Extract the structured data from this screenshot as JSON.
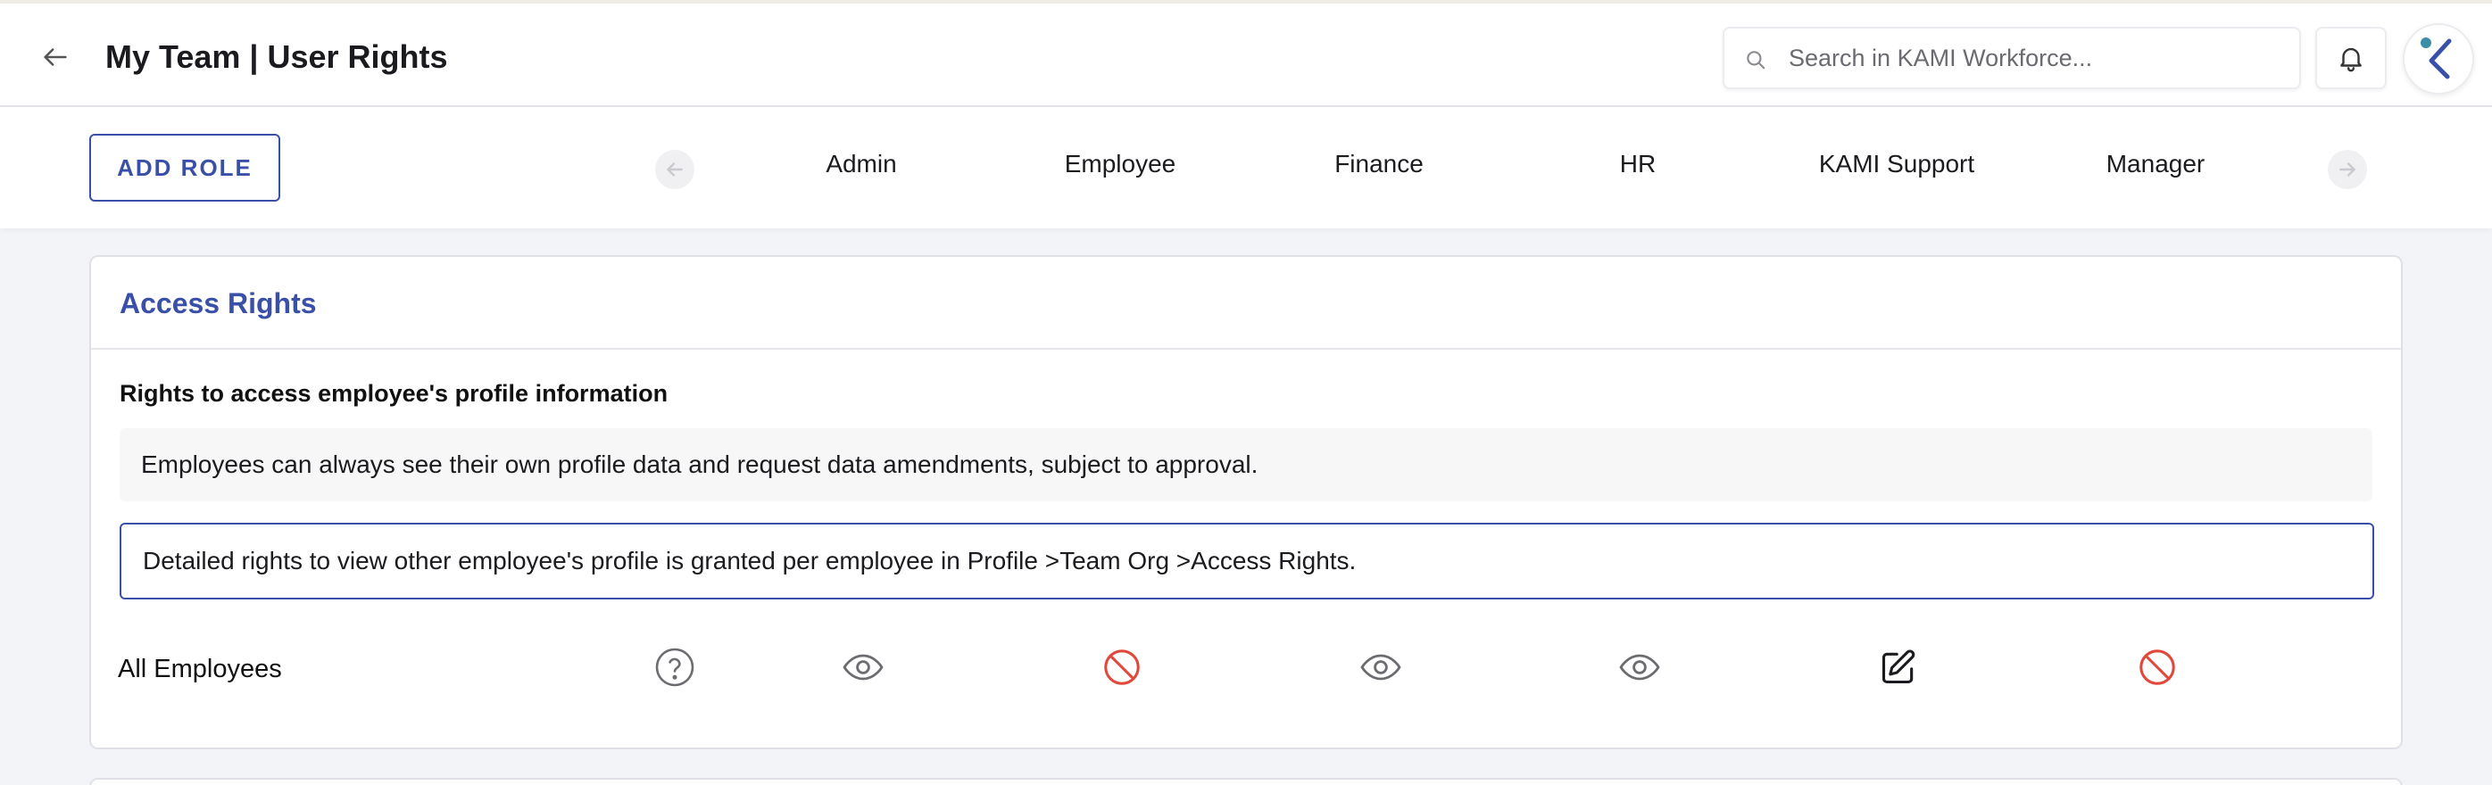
{
  "header": {
    "title": "My Team | User Rights",
    "back_icon": "arrow-left-icon",
    "search": {
      "placeholder": "Search in KAMI Workforce...",
      "value": "",
      "icon": "search-icon"
    },
    "notifications_icon": "bell-icon",
    "avatar_icon": "kami-logo"
  },
  "toolbar": {
    "add_role_label": "ADD ROLE",
    "prev_icon": "arrow-left-circle-icon",
    "next_icon": "arrow-right-circle-icon"
  },
  "roles": [
    {
      "label": "Admin"
    },
    {
      "label": "Employee"
    },
    {
      "label": "Finance"
    },
    {
      "label": "HR"
    },
    {
      "label": "KAMI Support"
    },
    {
      "label": "Manager"
    }
  ],
  "access_rights": {
    "title": "Access Rights",
    "section_heading": "Rights to access employee's profile information",
    "info_text": "Employees can always see their own profile data and request data amendments, subject to approval.",
    "notice_text": "Detailed rights to view other employee's profile is granted per employee in Profile >Team Org >Access Rights.",
    "rows": [
      {
        "label": "All Employees",
        "help_icon": "help-circle-icon",
        "permissions": [
          {
            "role": "Admin",
            "icon": "eye-icon"
          },
          {
            "role": "Employee",
            "icon": "no-access-icon"
          },
          {
            "role": "Finance",
            "icon": "eye-icon"
          },
          {
            "role": "HR",
            "icon": "eye-icon"
          },
          {
            "role": "KAMI Support",
            "icon": "edit-icon"
          },
          {
            "role": "Manager",
            "icon": "no-access-icon"
          }
        ]
      }
    ]
  },
  "colors": {
    "accent": "#3a4fa8",
    "deny": "#e0483c",
    "view": "#6b6b70",
    "background": "#f3f4f8"
  }
}
